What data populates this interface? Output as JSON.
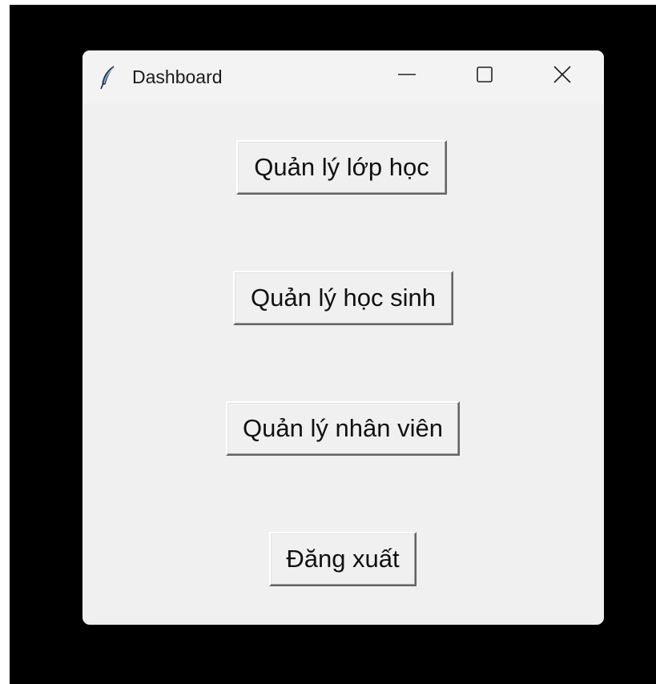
{
  "window": {
    "title": "Dashboard",
    "app_icon": "feather-icon",
    "controls": {
      "minimize_icon": "minimize-icon",
      "maximize_icon": "maximize-icon",
      "close_icon": "close-icon"
    }
  },
  "main": {
    "buttons": [
      {
        "label": "Quản lý lớp học"
      },
      {
        "label": "Quản lý học sinh"
      },
      {
        "label": "Quản lý nhân viên"
      },
      {
        "label": "Đăng xuất"
      }
    ]
  },
  "colors": {
    "screen_background": "#000000",
    "window_background": "#f0f0f0",
    "titlebar_background": "#f3f3f3",
    "text": "#111111"
  }
}
